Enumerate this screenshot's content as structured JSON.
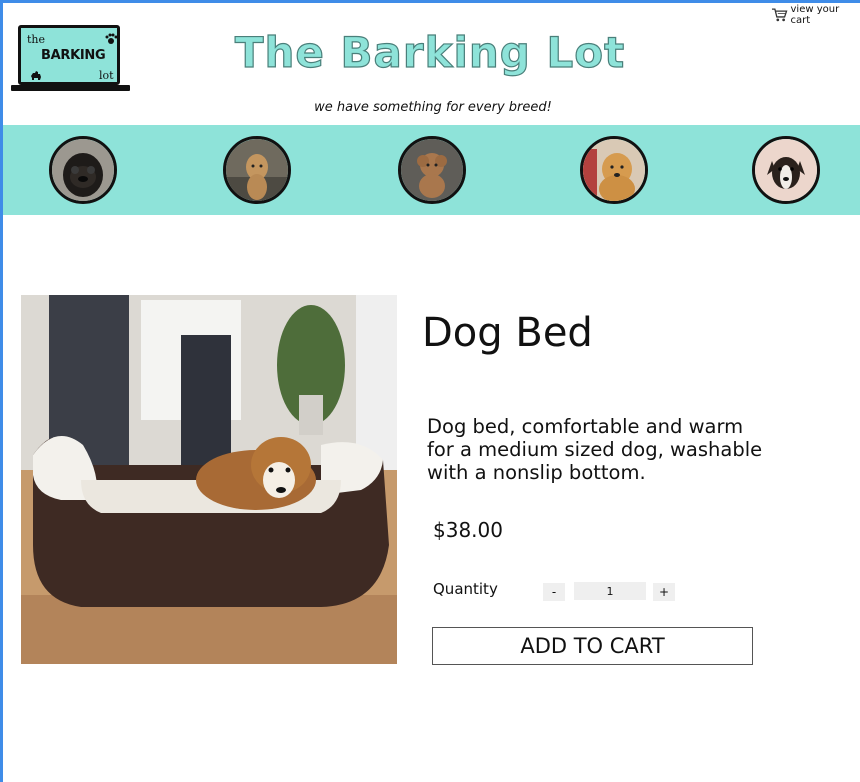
{
  "header": {
    "logo": {
      "line1": "the",
      "line2": "BARKING",
      "line3": "lot"
    },
    "title": "The Barking Lot",
    "tagline": "we have something for every breed!",
    "cart_link": "view your cart"
  },
  "breeds": [
    {
      "name": "pug"
    },
    {
      "name": "goldendoodle"
    },
    {
      "name": "poodle-mix"
    },
    {
      "name": "golden-retriever"
    },
    {
      "name": "beagle-mix"
    }
  ],
  "product": {
    "title": "Dog Bed",
    "description": "Dog bed, comfortable and warm for a medium sized dog, washable with a nonslip bottom.",
    "price": "$38.00",
    "quantity_label": "Quantity",
    "quantity": "1",
    "minus_label": "-",
    "plus_label": "+",
    "add_to_cart": "ADD TO CART"
  },
  "colors": {
    "accent": "#8ee3d9",
    "frame": "#3f8ce8",
    "text": "#111111"
  }
}
